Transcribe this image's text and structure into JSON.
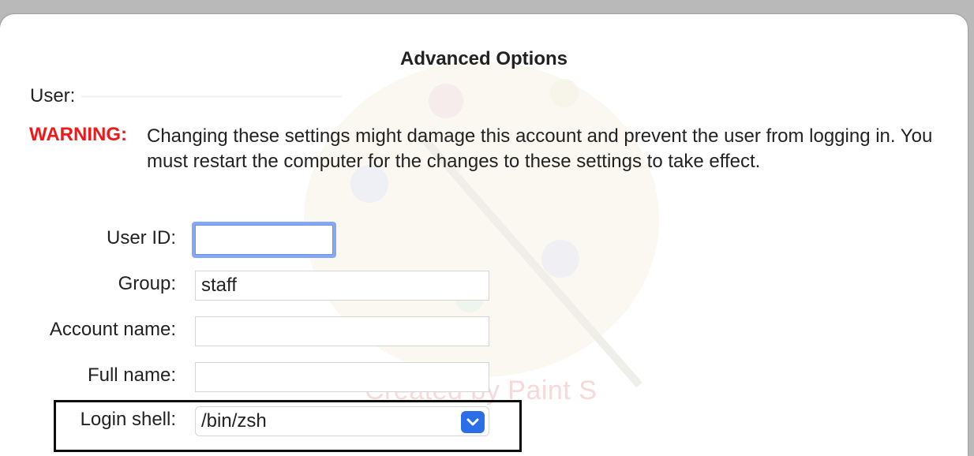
{
  "dialog": {
    "title": "Advanced Options",
    "user_label": "User:",
    "warning_label": "WARNING:",
    "warning_text": "Changing these settings might damage this account and prevent the user from logging in. You must restart the computer for the changes to these settings to take effect."
  },
  "fields": {
    "user_id_label": "User ID:",
    "user_id_value": "",
    "group_label": "Group:",
    "group_value": "staff",
    "account_name_label": "Account name:",
    "account_name_value": "",
    "full_name_label": "Full name:",
    "full_name_value": "",
    "login_shell_label": "Login shell:",
    "login_shell_value": "/bin/zsh"
  },
  "watermark": {
    "text": "Created by Paint S"
  },
  "colors": {
    "warning": "#f01818",
    "focus_ring": "#86a8f4",
    "select_button": "#2b6fe6"
  },
  "icons": {
    "select": "chevron-down-icon"
  }
}
